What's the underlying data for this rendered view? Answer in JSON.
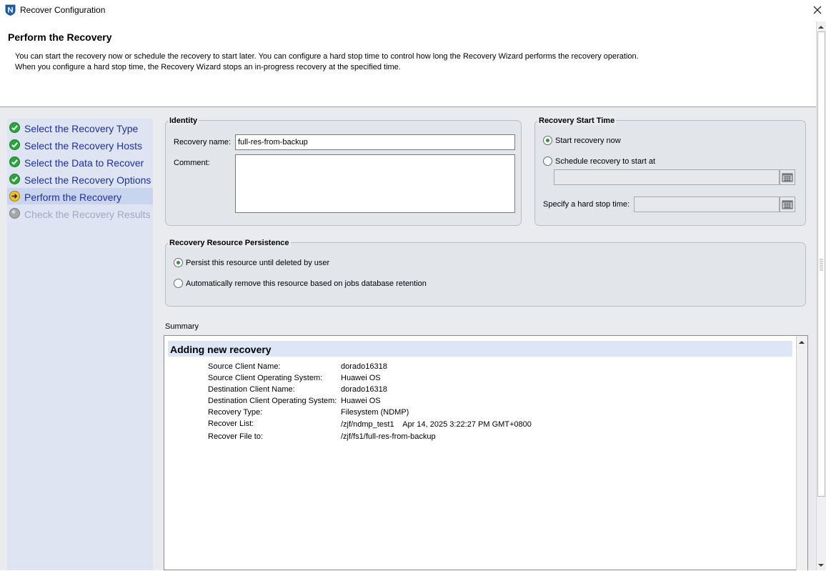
{
  "window": {
    "title": "Recover Configuration",
    "app_icon": "networker-shield-icon",
    "close_icon": "close-icon"
  },
  "header": {
    "title": "Perform the Recovery",
    "description_line1": "You can start the recovery now or schedule the recovery to start later.  You can configure a hard stop time to control how long the Recovery Wizard performs the recovery operation.",
    "description_line2": "When you configure a hard stop time, the Recovery Wizard stops an in-progress recovery at the specified time."
  },
  "steps": [
    {
      "label": "Select the Recovery Type",
      "status": "complete",
      "icon": "check-circle-icon"
    },
    {
      "label": "Select the Recovery Hosts",
      "status": "complete",
      "icon": "check-circle-icon"
    },
    {
      "label": "Select the Data to Recover",
      "status": "complete",
      "icon": "check-circle-icon"
    },
    {
      "label": "Select the Recovery Options",
      "status": "complete",
      "icon": "check-circle-icon"
    },
    {
      "label": "Perform the Recovery",
      "status": "current",
      "icon": "arrow-circle-icon"
    },
    {
      "label": "Check the Recovery Results",
      "status": "pending",
      "icon": "gray-circle-icon"
    }
  ],
  "identity": {
    "title": "Identity",
    "name_label": "Recovery name:",
    "name_value": "full-res-from-backup",
    "comment_label": "Comment:",
    "comment_value": ""
  },
  "start_time": {
    "title": "Recovery Start Time",
    "option_now": "Start recovery now",
    "option_schedule": "Schedule recovery to start at",
    "selected": "now",
    "schedule_value": "",
    "hard_stop_label": "Specify a hard stop time:",
    "hard_stop_value": ""
  },
  "persistence": {
    "title": "Recovery Resource Persistence",
    "option_persist": "Persist this resource until deleted by user",
    "option_auto_remove": "Automatically remove this resource based on jobs database retention",
    "selected": "persist"
  },
  "summary": {
    "label": "Summary",
    "heading": "Adding new recovery",
    "rows": [
      {
        "key": "Source Client Name:",
        "value": "dorado16318"
      },
      {
        "key": "Source Client Operating System:",
        "value": "Huawei OS"
      },
      {
        "key": "Destination Client Name:",
        "value": "dorado16318"
      },
      {
        "key": "Destination Client Operating System:",
        "value": "Huawei OS"
      },
      {
        "key": "Recovery Type:",
        "value": "Filesystem (NDMP)"
      },
      {
        "key": "Recover List:",
        "value": "/zjf/ndmp_test1    Apr 14, 2025 3:22:27 PM GMT+0800"
      },
      {
        "key": "Recover File to:",
        "value": "/zjf/fs1/full-res-from-backup"
      }
    ]
  },
  "colors": {
    "step_link": "#1d2fa3",
    "step_disabled": "#9ea9c6",
    "sidebar_bg": "#dfe4f2",
    "active_step_bg": "#c9d5ee",
    "panel_bg": "#e9ebef",
    "summary_heading_bg": "#dce6f7",
    "radio_dot": "#2d9a2d"
  }
}
